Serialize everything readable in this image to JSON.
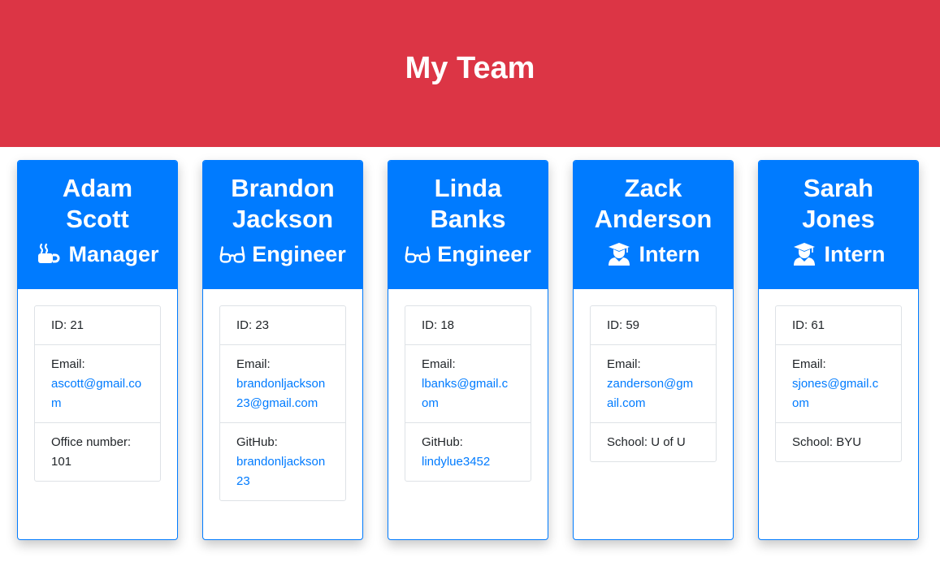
{
  "header": {
    "title": "My Team"
  },
  "colors": {
    "header_bg": "#dc3545",
    "card_header_bg": "#007bff",
    "link": "#007bff"
  },
  "employees": [
    {
      "name": "Adam Scott",
      "role": "Manager",
      "role_icon": "mug-hot-icon",
      "id_text": "ID: 21",
      "email_label": "Email:",
      "email": "ascott@gmail.com",
      "extra_label": "Office number:",
      "extra_value": "101"
    },
    {
      "name": "Brandon Jackson",
      "role": "Engineer",
      "role_icon": "glasses-icon",
      "id_text": "ID: 23",
      "email_label": "Email:",
      "email": "brandonljackson23@gmail.com",
      "extra_label": "GitHub:",
      "extra_value": "brandonljackson23"
    },
    {
      "name": "Linda Banks",
      "role": "Engineer",
      "role_icon": "glasses-icon",
      "id_text": "ID: 18",
      "email_label": "Email:",
      "email": "lbanks@gmail.com",
      "extra_label": "GitHub:",
      "extra_value": "lindylue3452"
    },
    {
      "name": "Zack Anderson",
      "role": "Intern",
      "role_icon": "user-graduate-icon",
      "id_text": "ID: 59",
      "email_label": "Email:",
      "email": "zanderson@gmail.com",
      "extra_text": "School: U of U"
    },
    {
      "name": "Sarah Jones",
      "role": "Intern",
      "role_icon": "user-graduate-icon",
      "id_text": "ID: 61",
      "email_label": "Email:",
      "email": "sjones@gmail.com",
      "extra_text": "School: BYU"
    }
  ]
}
